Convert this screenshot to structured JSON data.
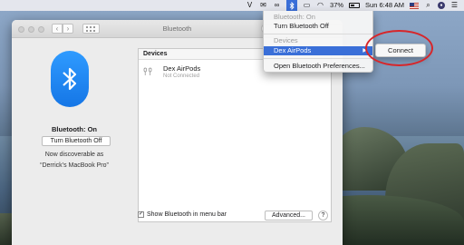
{
  "menubar": {
    "clock": "Sun 6:48 AM",
    "battery": "37%",
    "icons": [
      "v-icon",
      "mail-icon",
      "creative-cloud-icon",
      "bluetooth-icon",
      "airplay-icon",
      "wifi-icon",
      "battery-icon",
      "flag-icon",
      "search-icon",
      "user-icon",
      "menu-icon"
    ]
  },
  "window": {
    "title": "Bluetooth",
    "left": {
      "status": "Bluetooth: On",
      "toggle_button": "Turn Bluetooth Off",
      "discoverable_line1": "Now discoverable as",
      "discoverable_line2": "“Derrick’s MacBook Pro”"
    },
    "devices": {
      "header": "Devices",
      "items": [
        {
          "name": "Dex AirPods",
          "status": "Not Connected"
        }
      ]
    },
    "show_in_menubar_label": "Show Bluetooth in menu bar",
    "show_in_menubar_checked": true,
    "advanced_button": "Advanced...",
    "help_button": "?"
  },
  "dropdown": {
    "status": "Bluetooth: On",
    "toggle": "Turn Bluetooth Off",
    "section_header": "Devices",
    "device": "Dex AirPods",
    "preferences": "Open Bluetooth Preferences..."
  },
  "submenu": {
    "connect": "Connect"
  },
  "colors": {
    "accent": "#3a6fd8",
    "bluetooth": "#1c86f2",
    "annotation": "#d7262a"
  }
}
